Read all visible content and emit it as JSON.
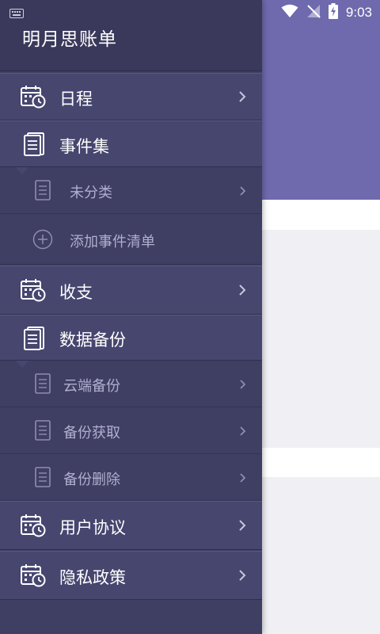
{
  "status": {
    "time": "9:03"
  },
  "drawer": {
    "title": "明月思账单",
    "menu": {
      "schedule": "日程",
      "events": "事件集",
      "uncategorized": "未分类",
      "add_event_list": "添加事件清单",
      "income_expense": "收支",
      "data_backup": "数据备份",
      "cloud_backup": "云端备份",
      "backup_fetch": "备份获取",
      "backup_delete": "备份删除",
      "user_agreement": "用户协议",
      "privacy_policy": "隐私政策"
    }
  },
  "colors": {
    "drawer_bg": "#3f3e63",
    "drawer_row": "#47466f",
    "accent_header": "#6e6aad",
    "content_bg": "#efeff4"
  }
}
